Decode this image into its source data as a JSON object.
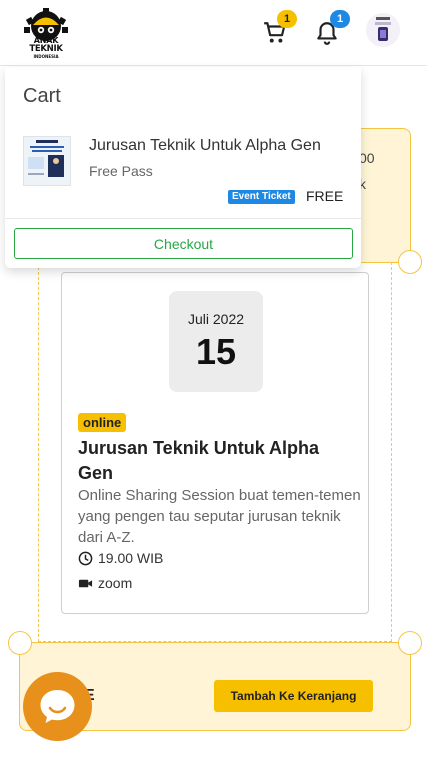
{
  "header": {
    "logo": {
      "line1": "ANAK",
      "line2": "TEKNIK",
      "line3": "INDONESIA"
    },
    "cart_count": "1",
    "notification_count": "1",
    "icons": {
      "cart": "cart-icon",
      "bell": "bell-icon",
      "avatar": "user-avatar"
    }
  },
  "background": {
    "partial_text_1": "00",
    "partial_text_2": "k",
    "event": {
      "month_year": "Juli 2022",
      "day": "15",
      "type_badge": "online",
      "title": "Jurusan Teknik Untuk Alpha Gen",
      "description": "Online Sharing Session buat temen-temen yang pengen tau seputar jurusan teknik dari A-Z.",
      "time": "19.00 WIB",
      "location": "zoom"
    },
    "price_partial": "E",
    "add_to_cart_label": "Tambah Ke Keranjang"
  },
  "cart": {
    "title": "Cart",
    "items": [
      {
        "name": "Jurusan Teknik Untuk Alpha Gen",
        "ticket_name": "Free Pass",
        "type_badge": "Event Ticket",
        "price": "FREE"
      }
    ],
    "checkout_label": "Checkout"
  },
  "colors": {
    "accent_yellow": "#f6c000",
    "ticket_bg": "#fff4d6",
    "badge_blue": "#1e88e5",
    "checkout_green": "#28a745",
    "chat_orange": "#e8901c"
  }
}
